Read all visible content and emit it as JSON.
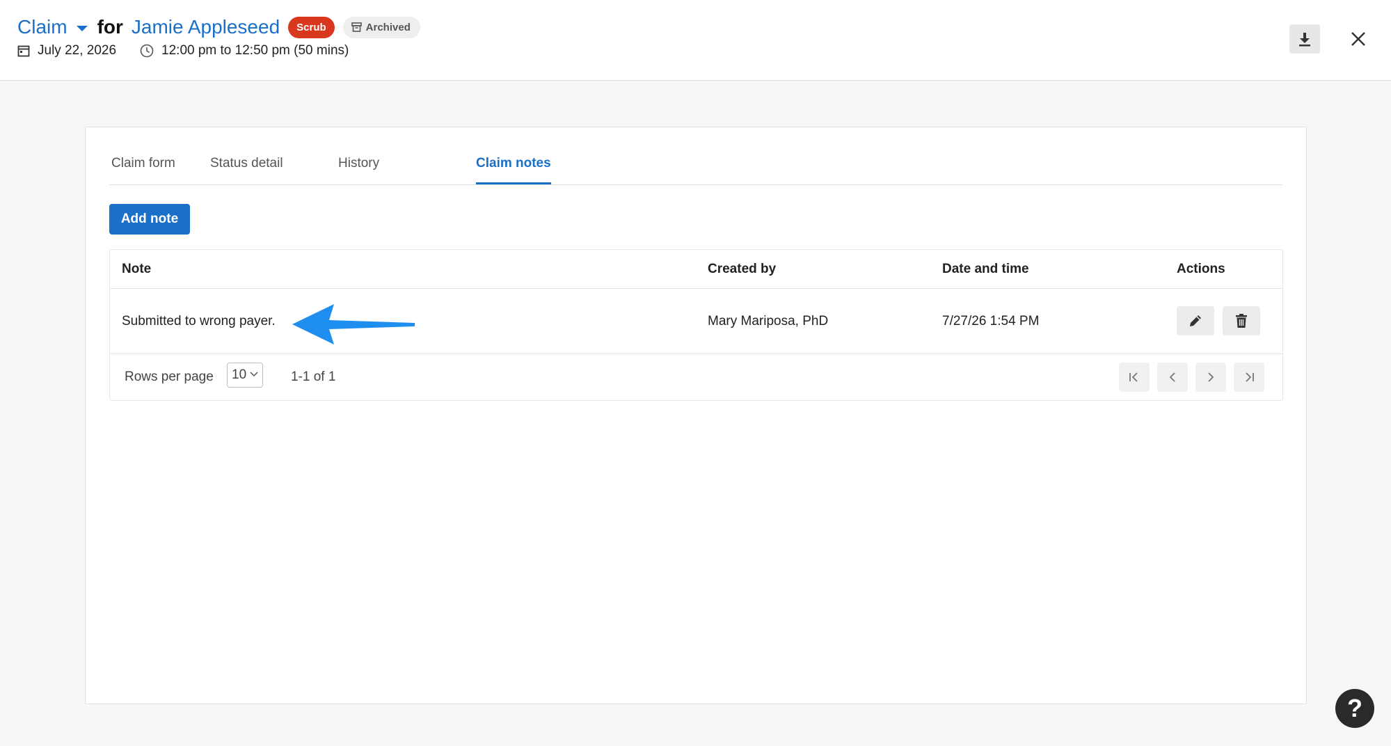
{
  "header": {
    "claim_label": "Claim",
    "for_label": "for",
    "patient_name": "Jamie Appleseed",
    "scrub_badge": "Scrub",
    "archived_badge": "Archived",
    "date": "July 22, 2026",
    "time_range": "12:00 pm to 12:50 pm (50 mins)"
  },
  "tabs": [
    {
      "label": "Claim form",
      "active": false
    },
    {
      "label": "Status detail",
      "active": false
    },
    {
      "label": "History",
      "active": false
    },
    {
      "label": "Claim notes",
      "active": true
    }
  ],
  "add_note_label": "Add note",
  "table": {
    "columns": [
      "Note",
      "Created by",
      "Date and time",
      "Actions"
    ],
    "rows": [
      {
        "note": "Submitted to wrong payer.",
        "created_by": "Mary Mariposa, PhD",
        "date_time": "7/27/26 1:54 PM"
      }
    ]
  },
  "pagination": {
    "rows_per_page_label": "Rows per page",
    "rows_per_page_value": "10",
    "range": "1-1 of 1"
  },
  "help_label": "?",
  "colors": {
    "accent": "#1a6fc9",
    "scrub": "#d9381e",
    "annotation_arrow": "#1e8ff0"
  }
}
